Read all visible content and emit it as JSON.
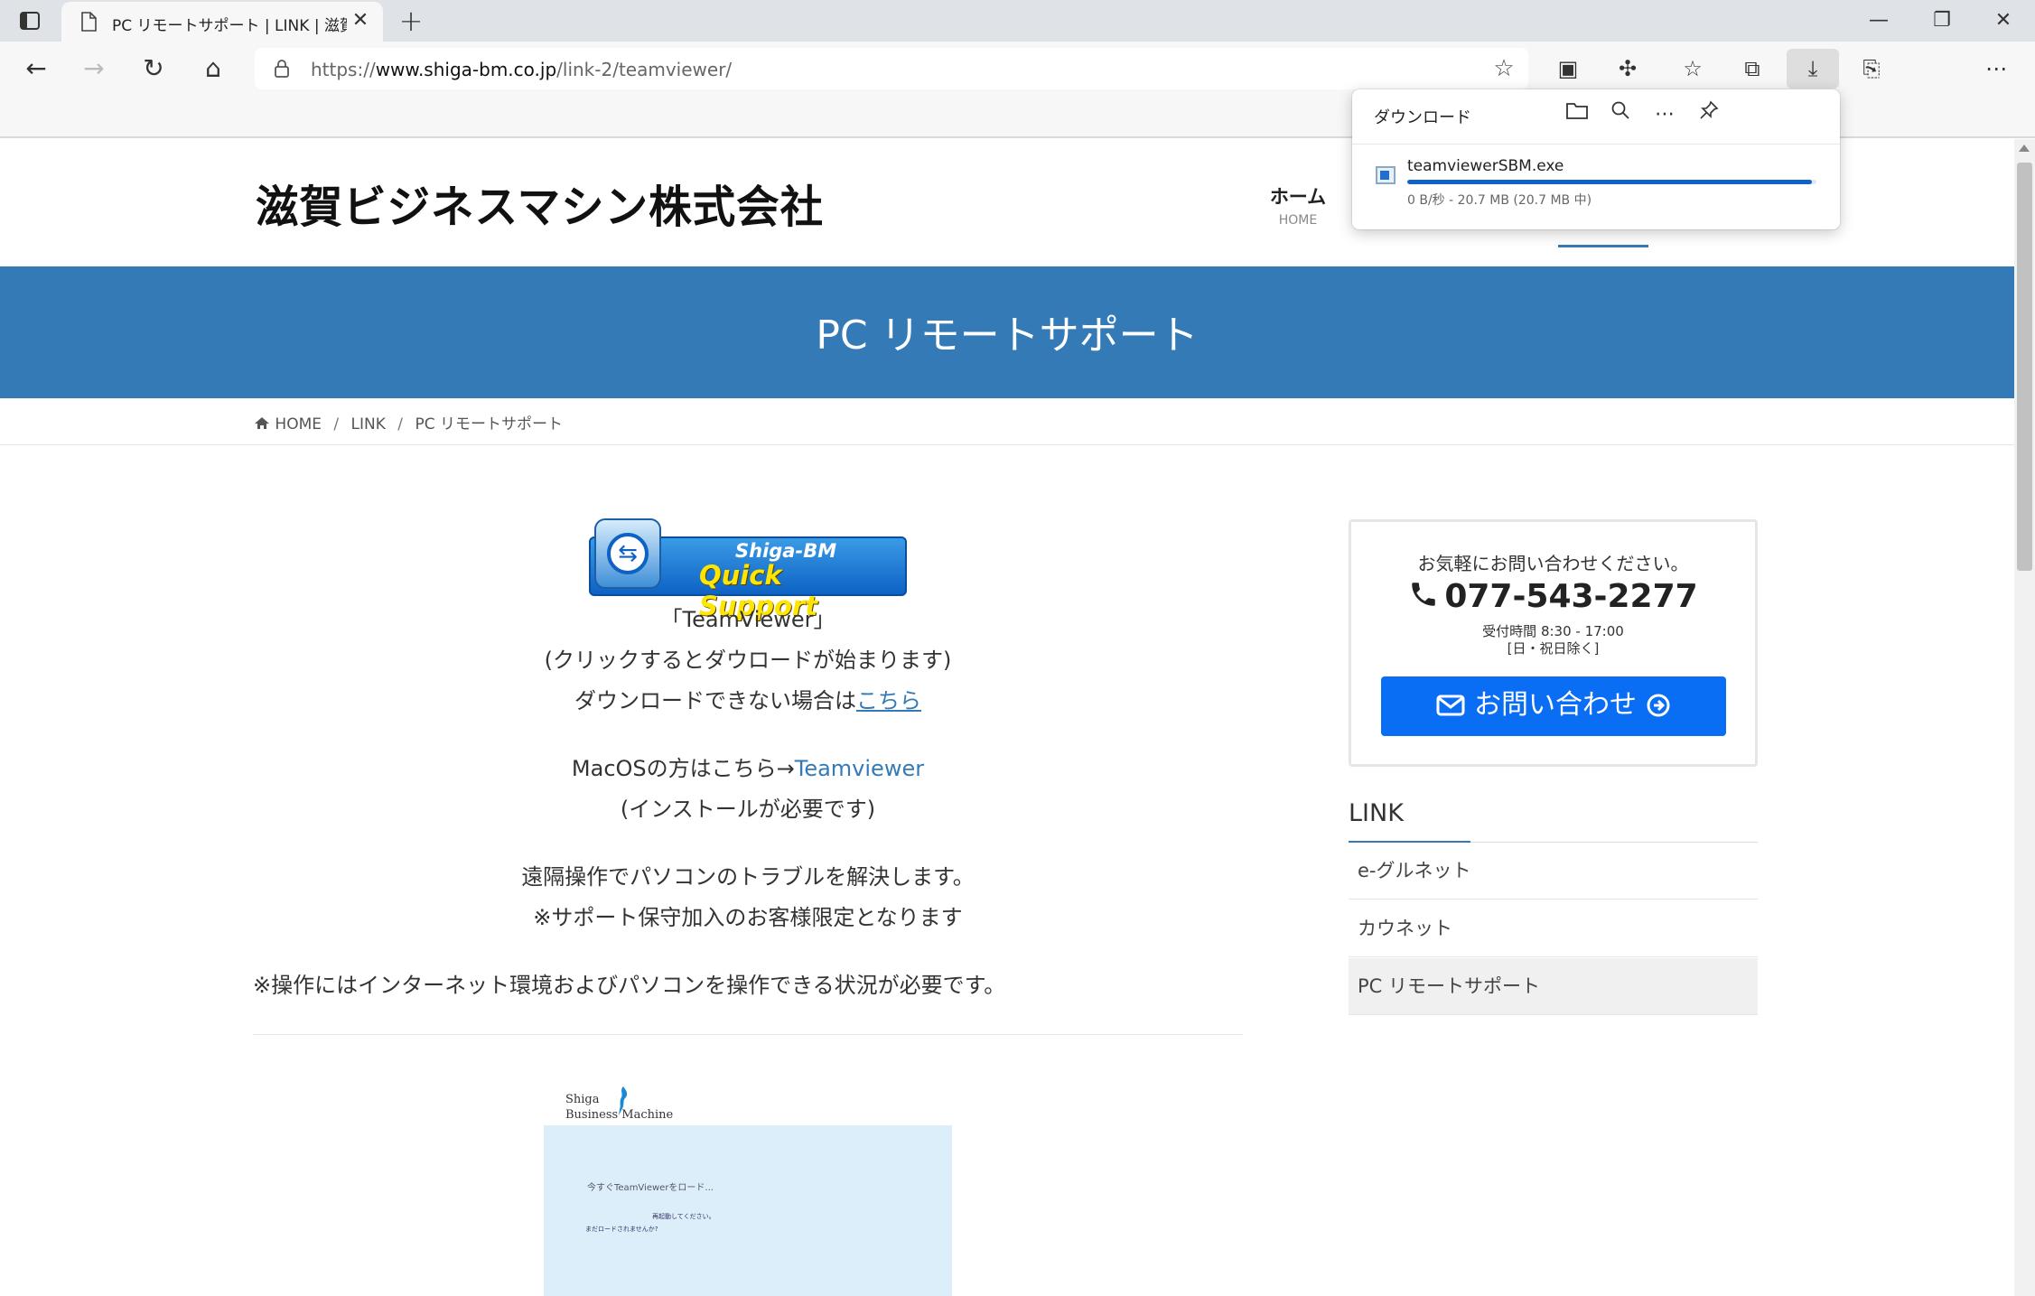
{
  "browser": {
    "tab_title": "PC リモートサポート | LINK | 滋賀ビジ",
    "url_prefix": "https://",
    "url_host": "www.shiga-bm.co.jp",
    "url_path": "/link-2/teamviewer/"
  },
  "download_panel": {
    "title": "ダウンロード",
    "file_name": "teamviewerSBM.exe",
    "status": "0 B/秒 - 20.7 MB (20.7 MB 中)",
    "progress_fraction": 0.99
  },
  "site": {
    "logo_text": "滋賀ビジネスマシン株式会社",
    "nav": {
      "home_jp": "ホーム",
      "home_en": "HOME"
    }
  },
  "hero": {
    "title": "PC リモートサポート"
  },
  "breadcrumb": {
    "home": "HOME",
    "link": "LINK",
    "current": "PC リモートサポート"
  },
  "main": {
    "quick_support": {
      "line1": "Shiga-BM",
      "line2": "Quick Support"
    },
    "teamviewer_caption": "「TeamViewer」",
    "click_note": "(クリックするとダウロードが始まります)",
    "cannot_download_prefix": "ダウンロードできない場合は",
    "cannot_download_link": "こちら",
    "mac_prefix": "MacOSの方はこちら→",
    "mac_link": "Teamviewer",
    "install_note": "(インストールが必要です)",
    "remote_desc": "遠隔操作でパソコンのトラブルを解決します。",
    "support_note": "※サポート保守加入のお客様限定となります",
    "requirement_note": "※操作にはインターネット環境およびパソコンを操作できる状況が必要です。",
    "screenshot": {
      "brand_line1": "Shiga",
      "brand_line2": "Business Machine",
      "text1": "今すぐTeamViewerをロード...",
      "text2": "再起動してください。",
      "text3": "まだロードされませんか?"
    }
  },
  "sidebar": {
    "contact": {
      "lead": "お気軽にお問い合わせください。",
      "phone": "077-543-2277",
      "hours": "受付時間 8:30 - 17:00",
      "closed": "[日・祝日除く]",
      "button": "お問い合わせ"
    },
    "link_title": "LINK",
    "links": [
      "e-グルネット",
      "カウネット",
      "PC リモートサポート"
    ]
  },
  "colors": {
    "brand_blue": "#337ab7",
    "contact_button": "#0a6ef5",
    "download_progress": "#0f62c7"
  }
}
